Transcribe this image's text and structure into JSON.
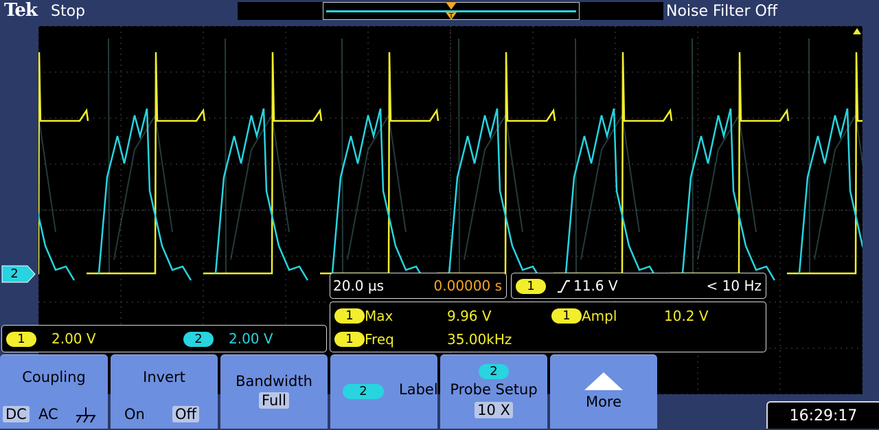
{
  "header": {
    "brand": "Tek",
    "acq_state": "Stop",
    "noise_filter": "Noise Filter Off"
  },
  "colors": {
    "ch1": "#f2ee2c",
    "ch2": "#27d4e0",
    "trigger": "#f5a623",
    "grid": "#4a4a4a",
    "menu": "#6d8fe0"
  },
  "channel_marker": {
    "label": "2"
  },
  "timebase": {
    "scale": "20.0 µs",
    "position": "0.00000 s"
  },
  "trigger": {
    "source": "1",
    "slope": "rising-edge-icon",
    "level": "11.6 V",
    "freq": "< 10 Hz"
  },
  "measurements": [
    {
      "channel": "1",
      "name": "Max",
      "value": "9.96 V"
    },
    {
      "channel": "1",
      "name": "Ampl",
      "value": "10.2 V"
    },
    {
      "channel": "1",
      "name": "Freq",
      "value": "35.00kHz"
    }
  ],
  "scales": [
    {
      "channel": "1",
      "value": "2.00 V"
    },
    {
      "channel": "2",
      "value": "2.00 V"
    }
  ],
  "menu": {
    "coupling": {
      "title": "Coupling",
      "opt_dc": "DC",
      "opt_ac": "AC",
      "selected": "DC"
    },
    "invert": {
      "title": "Invert",
      "opt_on": "On",
      "opt_off": "Off",
      "selected": "Off"
    },
    "bandwidth": {
      "title": "Bandwidth",
      "value": "Full"
    },
    "label": {
      "channel": "2",
      "title": "Label"
    },
    "probe": {
      "channel": "2",
      "title": "Probe Setup",
      "value": "10 X"
    },
    "more": {
      "title": "More"
    }
  },
  "clock": "16:29:17"
}
